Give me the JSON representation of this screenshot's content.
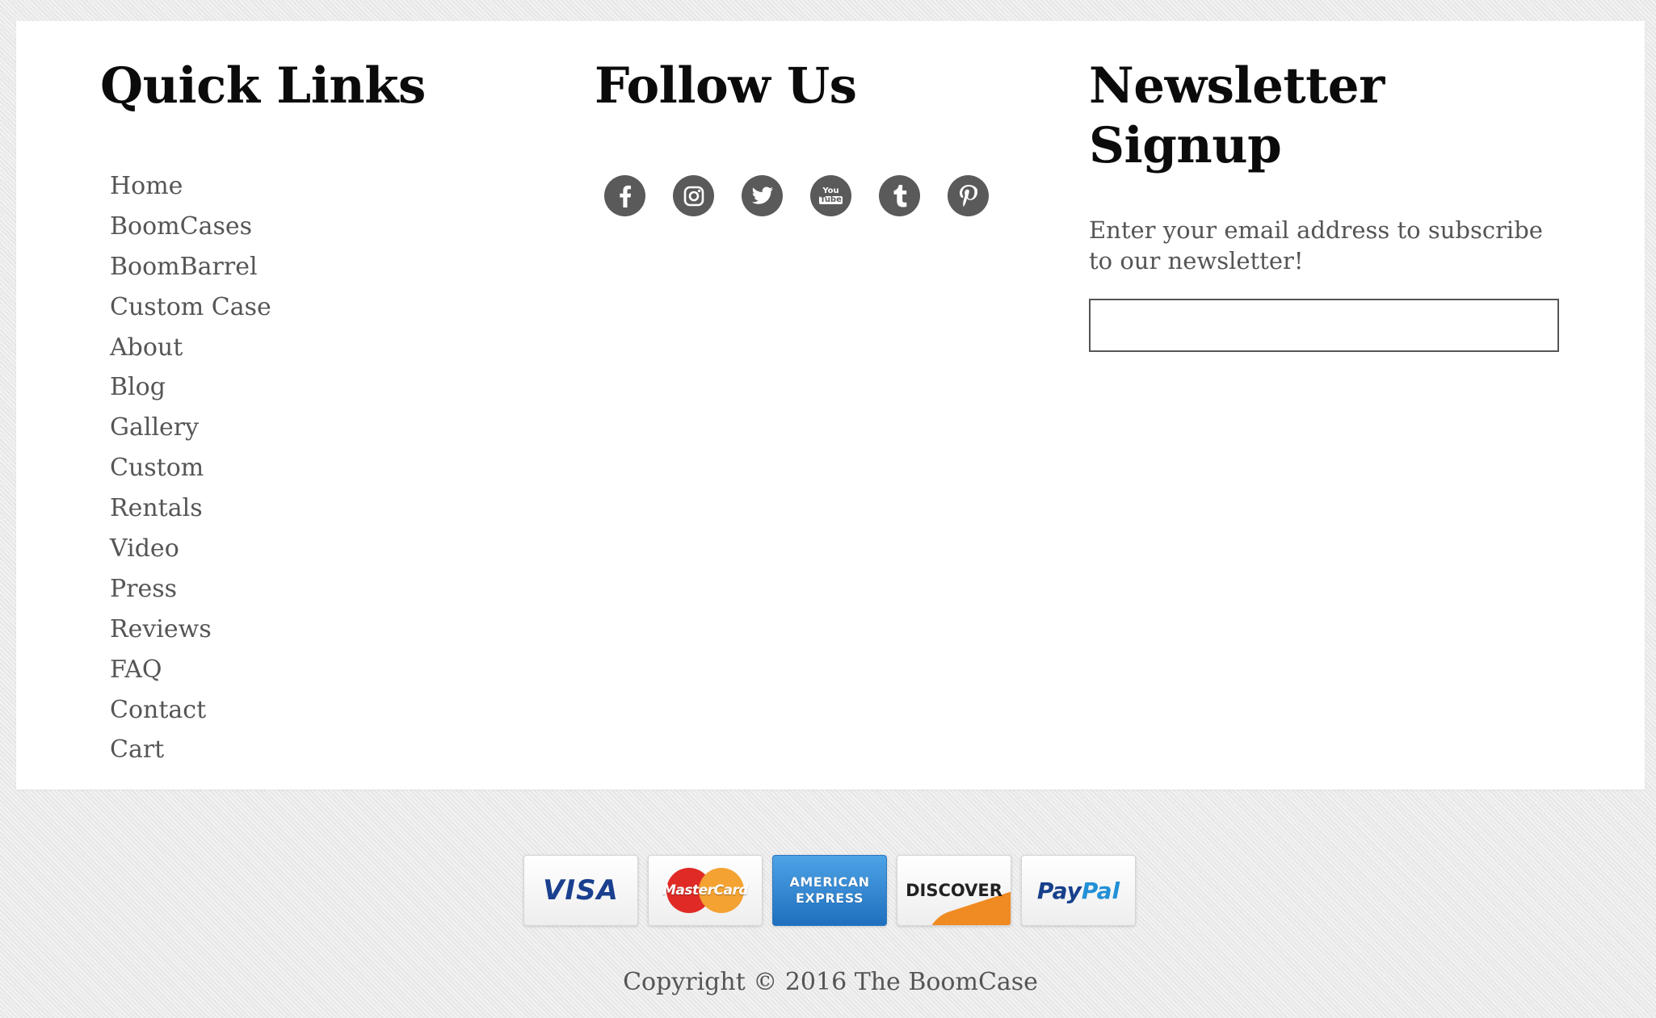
{
  "quick_links": {
    "title": "Quick Links",
    "items": [
      "Home",
      "BoomCases",
      "BoomBarrel",
      "Custom Case",
      "About",
      "Blog",
      "Gallery",
      "Custom",
      "Rentals",
      "Video",
      "Press",
      "Reviews",
      "FAQ",
      "Contact",
      "Cart"
    ]
  },
  "follow": {
    "title": "Follow Us",
    "icons": [
      "facebook-icon",
      "instagram-icon",
      "twitter-icon",
      "youtube-icon",
      "tumblr-icon",
      "pinterest-icon"
    ],
    "icon_color": "#5a5a5a"
  },
  "newsletter": {
    "title_line1": "Newsletter",
    "title_line2": "Signup",
    "description": "Enter your email address to subscribe to our newsletter!",
    "email_value": ""
  },
  "payments": {
    "visa": "VISA",
    "mastercard": "MasterCard",
    "amex_line1": "AMERICAN",
    "amex_line2": "EXPRESS",
    "discover": "DISCOVER",
    "paypal_pay": "Pay",
    "paypal_pal": "Pal"
  },
  "footer": {
    "copyright": "Copyright © 2016 The BoomCase"
  }
}
